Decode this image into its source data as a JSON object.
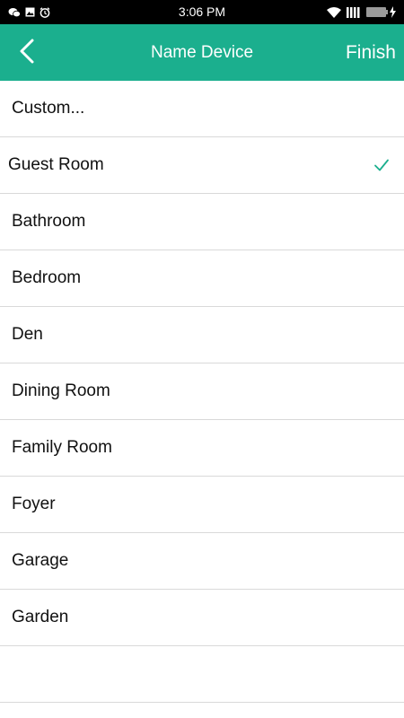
{
  "status_bar": {
    "time": "3:06 PM",
    "left_icons": [
      "wechat-icon",
      "image-icon",
      "alarm-icon"
    ],
    "right_icons": [
      "wifi-icon",
      "signal-icon",
      "battery-charging-icon"
    ]
  },
  "header": {
    "title": "Name Device",
    "back_icon": "chevron-left-icon",
    "finish_label": "Finish"
  },
  "colors": {
    "accent": "#1baf8e",
    "status_bar": "#000000",
    "divider": "#d9d9d9",
    "check": "#1baf8e"
  },
  "rooms": {
    "selected": "Guest Room",
    "items": [
      {
        "label": "Custom..."
      },
      {
        "label": "Guest Room",
        "checked": true
      },
      {
        "label": "Bathroom"
      },
      {
        "label": "Bedroom"
      },
      {
        "label": "Den"
      },
      {
        "label": "Dining Room"
      },
      {
        "label": "Family Room"
      },
      {
        "label": "Foyer"
      },
      {
        "label": "Garage"
      },
      {
        "label": "Garden"
      }
    ]
  }
}
